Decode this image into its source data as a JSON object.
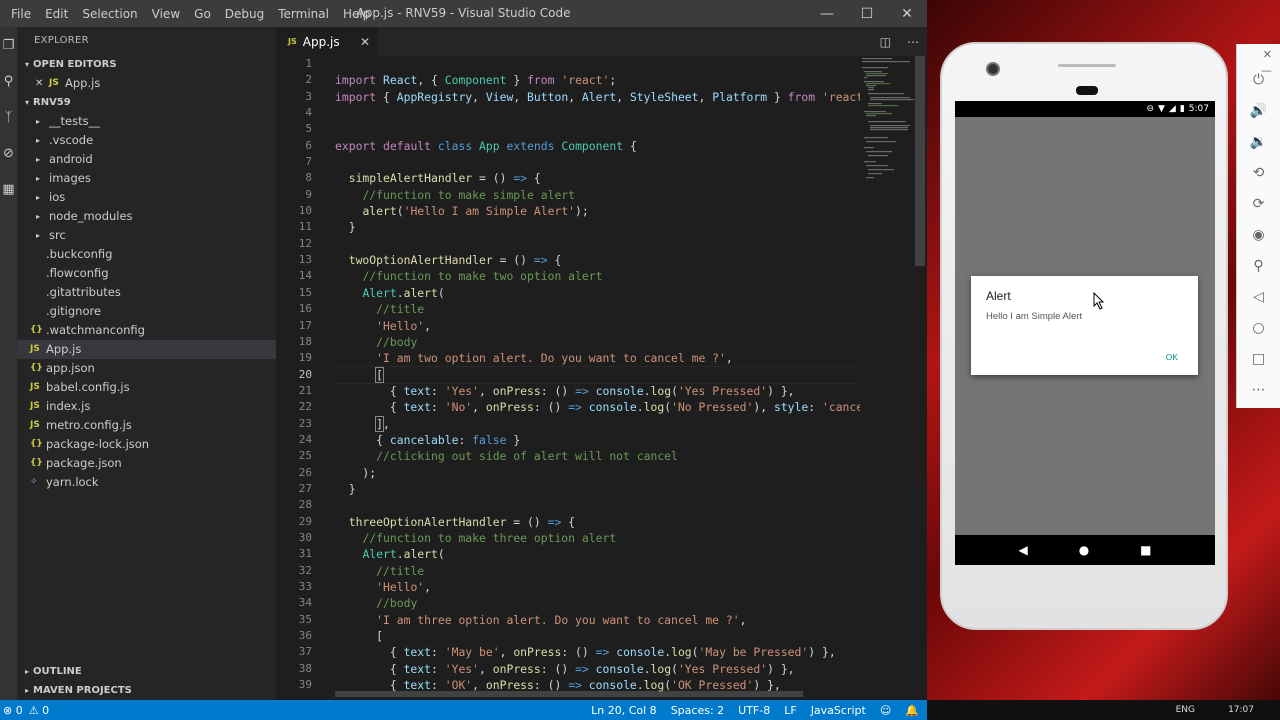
{
  "window": {
    "menu": [
      "File",
      "Edit",
      "Selection",
      "View",
      "Go",
      "Debug",
      "Terminal",
      "Help"
    ],
    "title": "App.js - RNV59 - Visual Studio Code"
  },
  "explorer": {
    "header": "EXPLORER",
    "open_editors_label": "OPEN EDITORS",
    "open_editor_file": "App.js",
    "project": "RNV59",
    "items": [
      {
        "name": "__tests__",
        "type": "folder"
      },
      {
        "name": ".vscode",
        "type": "folder"
      },
      {
        "name": "android",
        "type": "folder"
      },
      {
        "name": "images",
        "type": "folder"
      },
      {
        "name": "ios",
        "type": "folder"
      },
      {
        "name": "node_modules",
        "type": "folder"
      },
      {
        "name": "src",
        "type": "folder"
      },
      {
        "name": ".buckconfig",
        "type": "file"
      },
      {
        "name": ".flowconfig",
        "type": "file"
      },
      {
        "name": ".gitattributes",
        "type": "file"
      },
      {
        "name": ".gitignore",
        "type": "file"
      },
      {
        "name": ".watchmanconfig",
        "type": "json"
      },
      {
        "name": "App.js",
        "type": "js"
      },
      {
        "name": "app.json",
        "type": "json"
      },
      {
        "name": "babel.config.js",
        "type": "js"
      },
      {
        "name": "index.js",
        "type": "js"
      },
      {
        "name": "metro.config.js",
        "type": "js"
      },
      {
        "name": "package-lock.json",
        "type": "json"
      },
      {
        "name": "package.json",
        "type": "json"
      },
      {
        "name": "yarn.lock",
        "type": "yarn"
      }
    ],
    "outline_label": "OUTLINE",
    "maven_label": "MAVEN PROJECTS"
  },
  "editor": {
    "tab": "App.js",
    "current_line": 20,
    "line_numbers": [
      "1",
      "2",
      "3",
      "4",
      "5",
      "6",
      "7",
      "8",
      "9",
      "10",
      "11",
      "12",
      "13",
      "14",
      "15",
      "16",
      "17",
      "18",
      "19",
      "20",
      "21",
      "22",
      "23",
      "24",
      "25",
      "26",
      "27",
      "28",
      "29",
      "30",
      "31",
      "32",
      "33",
      "34",
      "35",
      "36",
      "37",
      "38",
      "39"
    ]
  },
  "statusbar": {
    "problems": "0",
    "warnings": "0",
    "position": "Ln 20, Col 8",
    "spaces": "Spaces: 2",
    "encoding": "UTF-8",
    "eol": "LF",
    "language": "JavaScript"
  },
  "emulator": {
    "time": "5:07",
    "dialog": {
      "title": "Alert",
      "message": "Hello I am Simple Alert",
      "ok": "OK"
    }
  },
  "taskbar": {
    "lang": "ENG",
    "clock": "17:07"
  }
}
